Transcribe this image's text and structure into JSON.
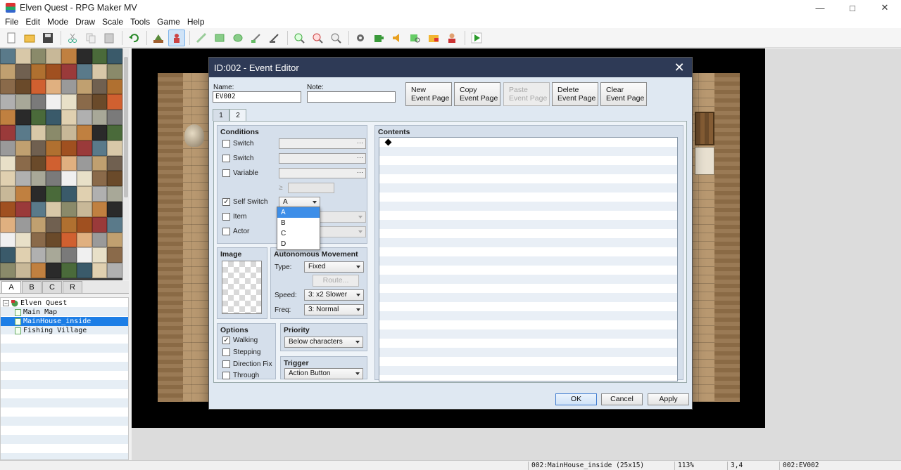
{
  "window": {
    "title": "Elven Quest - RPG Maker MV"
  },
  "menu": [
    "File",
    "Edit",
    "Mode",
    "Draw",
    "Scale",
    "Tools",
    "Game",
    "Help"
  ],
  "toolbar_icons": [
    "new-project-icon",
    "open-project-icon",
    "save-project-icon",
    "cut-icon",
    "copy-icon",
    "paste-icon",
    "undo-icon",
    "map-mode-icon",
    "event-mode-icon",
    "pencil-icon",
    "rectangle-icon",
    "ellipse-icon",
    "flood-fill-icon",
    "shadow-pen-icon",
    "zoom-in-icon",
    "zoom-out-icon",
    "actual-size-icon",
    "database-icon",
    "plugin-manager-icon",
    "sound-test-icon",
    "event-searcher-icon",
    "resource-manager-icon",
    "character-generator-icon",
    "playtest-icon"
  ],
  "tileset_tabs": [
    "A",
    "B",
    "C",
    "R"
  ],
  "map_tree": [
    {
      "label": "Elven Quest",
      "level": 0,
      "root": true
    },
    {
      "label": "Main Map",
      "level": 1
    },
    {
      "label": "MainHouse_inside",
      "level": 1,
      "selected": true
    },
    {
      "label": "Fishing Village",
      "level": 1
    }
  ],
  "status": {
    "map": "002:MainHouse_inside (25x15)",
    "zoom": "113%",
    "coords": "3,4",
    "event": "002:EV002"
  },
  "dialog": {
    "title": "ID:002 - Event Editor",
    "name_label": "Name:",
    "name_value": "EV002",
    "note_label": "Note:",
    "note_value": "",
    "buttons": {
      "new_page": "New\nEvent Page",
      "copy_page": "Copy\nEvent Page",
      "paste_page": "Paste\nEvent Page",
      "delete_page": "Delete\nEvent Page",
      "clear_page": "Clear\nEvent Page"
    },
    "page_tabs": [
      "1",
      "2"
    ],
    "active_page": "2",
    "conditions": {
      "title": "Conditions",
      "switch1": "Switch",
      "switch2": "Switch",
      "variable": "Variable",
      "ge_symbol": "≥",
      "self_switch": "Self Switch",
      "self_switch_checked": true,
      "self_switch_value": "A",
      "item": "Item",
      "actor": "Actor",
      "dropdown_options": [
        "A",
        "B",
        "C",
        "D"
      ],
      "dropdown_highlight": "A"
    },
    "image": {
      "title": "Image"
    },
    "autonomous": {
      "title": "Autonomous Movement",
      "type_label": "Type:",
      "type_value": "Fixed",
      "route_label": "Route...",
      "speed_label": "Speed:",
      "speed_value": "3: x2 Slower",
      "freq_label": "Freq:",
      "freq_value": "3: Normal"
    },
    "options": {
      "title": "Options",
      "walking": "Walking",
      "walking_checked": true,
      "stepping": "Stepping",
      "direction_fix": "Direction Fix",
      "through": "Through"
    },
    "priority": {
      "title": "Priority",
      "value": "Below characters"
    },
    "trigger": {
      "title": "Trigger",
      "value": "Action Button"
    },
    "contents": {
      "title": "Contents"
    },
    "ok": "OK",
    "cancel": "Cancel",
    "apply": "Apply"
  }
}
